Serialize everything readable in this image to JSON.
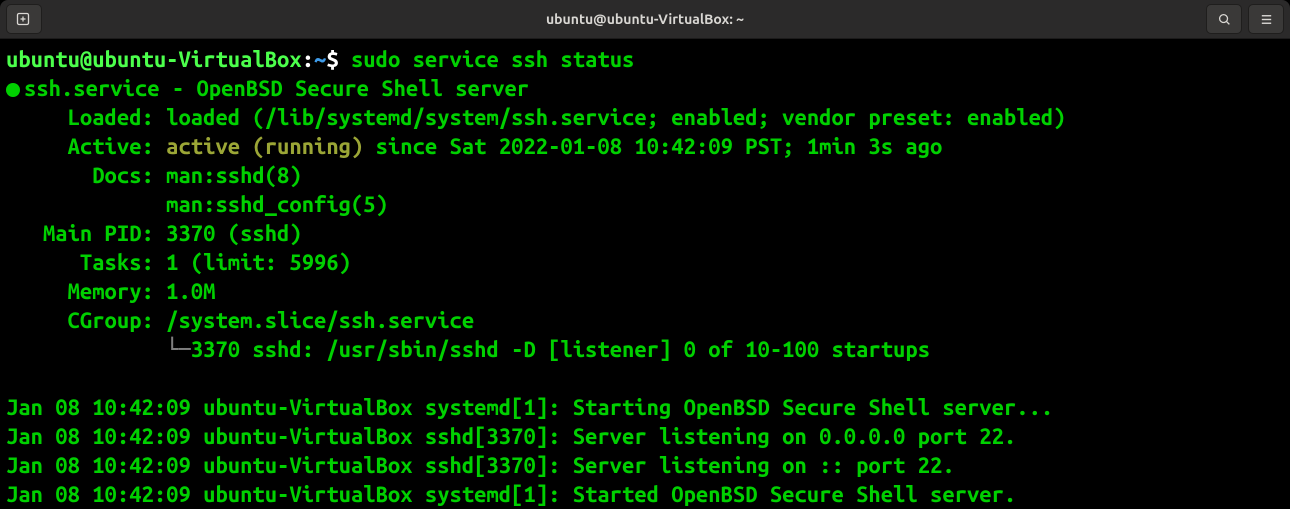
{
  "window": {
    "title": "ubuntu@ubuntu-VirtualBox: ~"
  },
  "prompt": {
    "userhost": "ubuntu@ubuntu-VirtualBox",
    "sep": ":",
    "cwd": "~",
    "dollar": "$ ",
    "command": "sudo service ssh status"
  },
  "service": {
    "header1": "ssh.service - OpenBSD Secure Shell server",
    "loaded_label": "     Loaded: ",
    "loaded_value": "loaded (/lib/systemd/system/ssh.service; enabled; vendor preset: enabled)",
    "active_label": "     Active: ",
    "active_value": "active (running)",
    "active_since": " since Sat 2022-01-08 10:42:09 PST; 1min 3s ago",
    "docs_label": "       Docs: ",
    "docs1": "man:sshd(8)",
    "docs2_indent": "             ",
    "docs2": "man:sshd_config(5)",
    "mainpid_label": "   Main PID: ",
    "mainpid_value": "3370 (sshd)",
    "tasks_label": "      Tasks: ",
    "tasks_value": "1 (limit: 5996)",
    "memory_label": "     Memory: ",
    "memory_value": "1.0M",
    "cgroup_label": "     CGroup: ",
    "cgroup_value": "/system.slice/ssh.service",
    "tree_indent": "             ",
    "tree_char": "└─",
    "tree_line": "3370 sshd: /usr/sbin/sshd -D [listener] 0 of 10-100 startups"
  },
  "logs": {
    "l1": "Jan 08 10:42:09 ubuntu-VirtualBox systemd[1]: Starting OpenBSD Secure Shell server...",
    "l2": "Jan 08 10:42:09 ubuntu-VirtualBox sshd[3370]: Server listening on 0.0.0.0 port 22.",
    "l3": "Jan 08 10:42:09 ubuntu-VirtualBox sshd[3370]: Server listening on :: port 22.",
    "l4": "Jan 08 10:42:09 ubuntu-VirtualBox systemd[1]: Started OpenBSD Secure Shell server."
  }
}
